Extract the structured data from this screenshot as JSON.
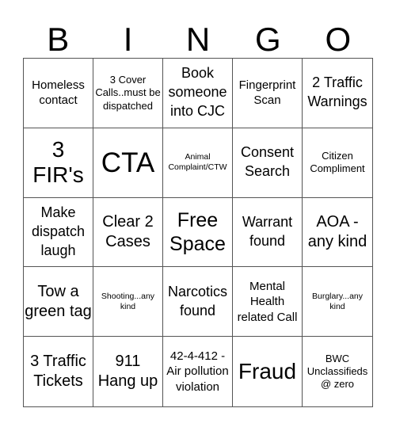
{
  "header": {
    "letters": [
      "B",
      "I",
      "N",
      "G",
      "O"
    ]
  },
  "board": {
    "rows": [
      [
        {
          "text": "Homeless contact",
          "size": "md"
        },
        {
          "text": "3 Cover Calls..must be dispatched",
          "size": "sm"
        },
        {
          "text": "Book someone into CJC",
          "size": "lg"
        },
        {
          "text": "Fingerprint Scan",
          "size": "md"
        },
        {
          "text": "2 Traffic Warnings",
          "size": "lg"
        }
      ],
      [
        {
          "text": "3 FIR's",
          "size": "huge"
        },
        {
          "text": "CTA",
          "size": "giant"
        },
        {
          "text": "Animal Complaint/CTW",
          "size": "xs"
        },
        {
          "text": "Consent Search",
          "size": "lg"
        },
        {
          "text": "Citizen Compliment",
          "size": "sm"
        }
      ],
      [
        {
          "text": "Make dispatch laugh",
          "size": "lg"
        },
        {
          "text": "Clear 2 Cases",
          "size": "xl"
        },
        {
          "text": "Free Space",
          "size": "xxl"
        },
        {
          "text": "Warrant found",
          "size": "lg"
        },
        {
          "text": "AOA - any kind",
          "size": "xl"
        }
      ],
      [
        {
          "text": "Tow a green tag",
          "size": "xl"
        },
        {
          "text": "Shooting...any kind",
          "size": "xs"
        },
        {
          "text": "Narcotics found",
          "size": "lg"
        },
        {
          "text": "Mental Health related Call",
          "size": "md"
        },
        {
          "text": "Burglary...any kind",
          "size": "xs"
        }
      ],
      [
        {
          "text": "3 Traffic Tickets",
          "size": "xl"
        },
        {
          "text": "911 Hang up",
          "size": "xl"
        },
        {
          "text": "42-4-412 - Air pollution violation",
          "size": "md"
        },
        {
          "text": "Fraud",
          "size": "huge"
        },
        {
          "text": "BWC Unclassifieds @ zero",
          "size": "sm"
        }
      ]
    ]
  }
}
